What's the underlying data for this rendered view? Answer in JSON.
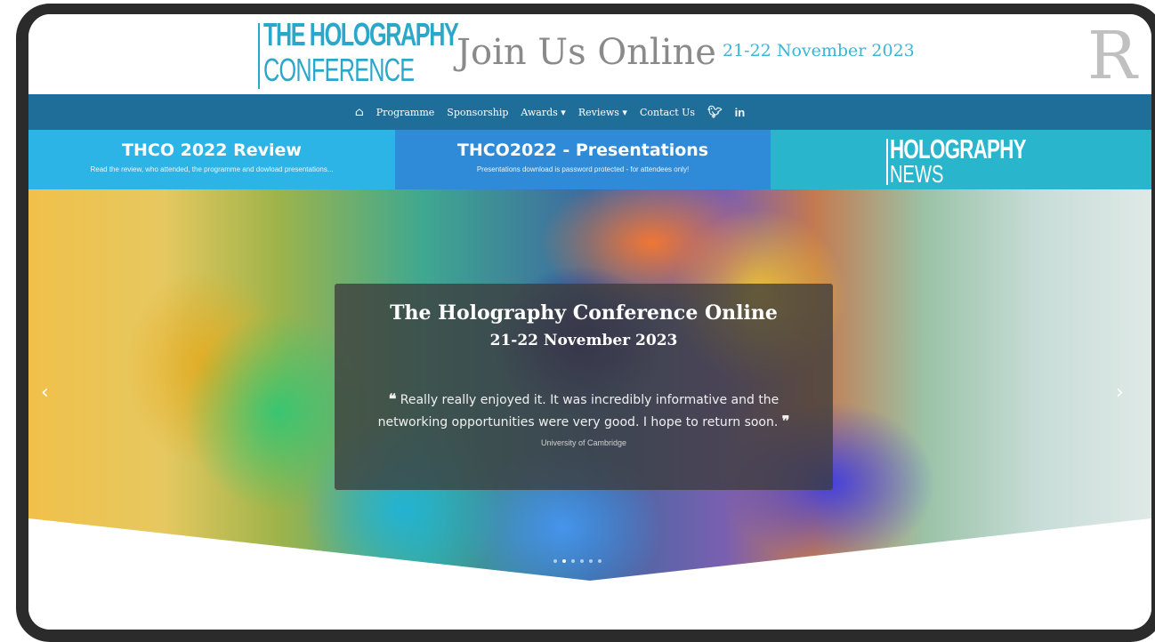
{
  "header": {
    "logo_line1": "THE HOLOGRAPHY",
    "logo_line2": "CONFERENCE",
    "headline": "Join Us Online",
    "dates": "21-22 November 2023",
    "partner_logo": "R"
  },
  "nav": {
    "home_icon": "home-icon",
    "items": [
      "Programme",
      "Sponsorship",
      "Awards",
      "Reviews",
      "Contact Us"
    ],
    "social": [
      "twitter-icon",
      "linkedin-icon"
    ]
  },
  "promos": [
    {
      "title": "THCO 2022 Review",
      "subtitle": "Read the review, who attended, the programme and dowload presentations..."
    },
    {
      "title": "THCO2022 - Presentations",
      "subtitle": "Presentations download is password protected - for attendees only!"
    },
    {
      "logo_line1": "HOLOGRAPHY",
      "logo_line2": "NEWS"
    }
  ],
  "hero": {
    "title": "The Holography Conference Online",
    "dates": "21-22 November 2023",
    "quote": "Really really enjoyed it. It was incredibly informative and the networking opportunities were very good. I hope to return soon.",
    "source": "University of Cambridge",
    "active_slide": 2,
    "slide_count": 6
  },
  "colors": {
    "frame": "#2b2b2b",
    "nav": "#1f6e9a",
    "promo1": "#2db4e6",
    "promo2": "#2f8ad8",
    "promo3": "#29b6cd",
    "accent": "#2aa7c9"
  }
}
